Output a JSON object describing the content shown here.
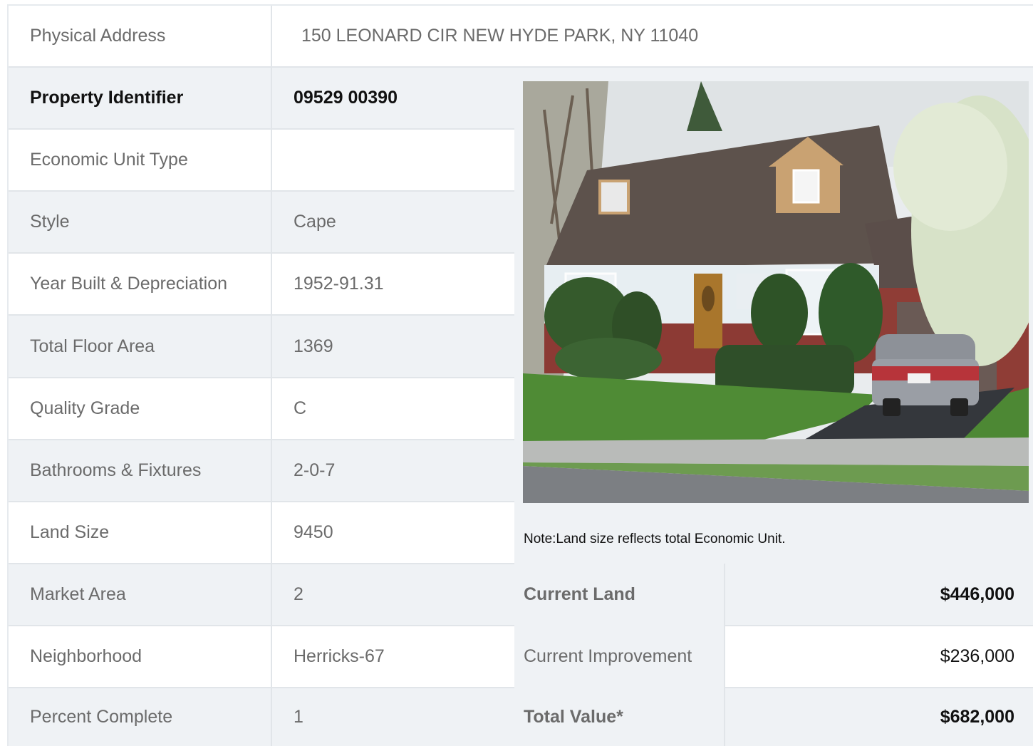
{
  "address": {
    "label": "Physical Address",
    "value": "150  LEONARD CIR  NEW HYDE PARK, NY  11040"
  },
  "rows": [
    {
      "label": "Property Identifier",
      "value": "09529  00390"
    },
    {
      "label": "Economic Unit Type",
      "value": ""
    },
    {
      "label": "Style",
      "value": "Cape"
    },
    {
      "label": "Year Built & Depreciation",
      "value": "1952-91.31"
    },
    {
      "label": "Total Floor Area",
      "value": "1369"
    },
    {
      "label": "Quality Grade",
      "value": "C"
    },
    {
      "label": "Bathrooms & Fixtures",
      "value": "2-0-7"
    },
    {
      "label": "Land Size",
      "value": "9450"
    },
    {
      "label": "Market Area",
      "value": "2"
    },
    {
      "label": "Neighborhood",
      "value": "Herricks-67"
    },
    {
      "label": "Percent Complete",
      "value": "1"
    }
  ],
  "note": "Note:Land size reflects total Economic Unit.",
  "values": {
    "current_land_label": "Current Land",
    "current_land_value": "$446,000",
    "current_improvement_label": "Current Improvement",
    "current_improvement_value": "$236,000",
    "total_value_label": "Total Value*",
    "total_value_value": "$682,000"
  },
  "colors": {
    "row_gray": "#eff2f5",
    "row_white": "#ffffff",
    "grid_line": "#e1e5e9",
    "text_muted": "#6b6b6b",
    "text_strong": "#111111"
  }
}
